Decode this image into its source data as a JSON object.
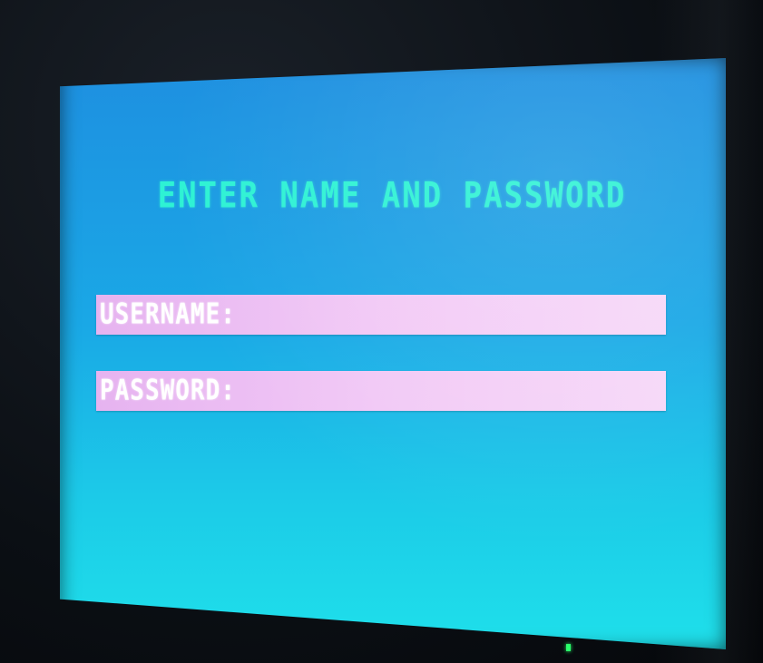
{
  "screen": {
    "title": "ENTER NAME AND PASSWORD",
    "fields": [
      {
        "label": "USERNAME:",
        "value": ""
      },
      {
        "label": "PASSWORD:",
        "value": ""
      }
    ]
  },
  "colors": {
    "screen_top": "#1e8fe0",
    "screen_bottom": "#1fe0ea",
    "title": "#2ef2d4",
    "field_bg": "#f2c9f6",
    "field_label": "#ffffff",
    "power_led": "#2aff6a"
  },
  "icons": {
    "power_led": "power-led-icon"
  }
}
